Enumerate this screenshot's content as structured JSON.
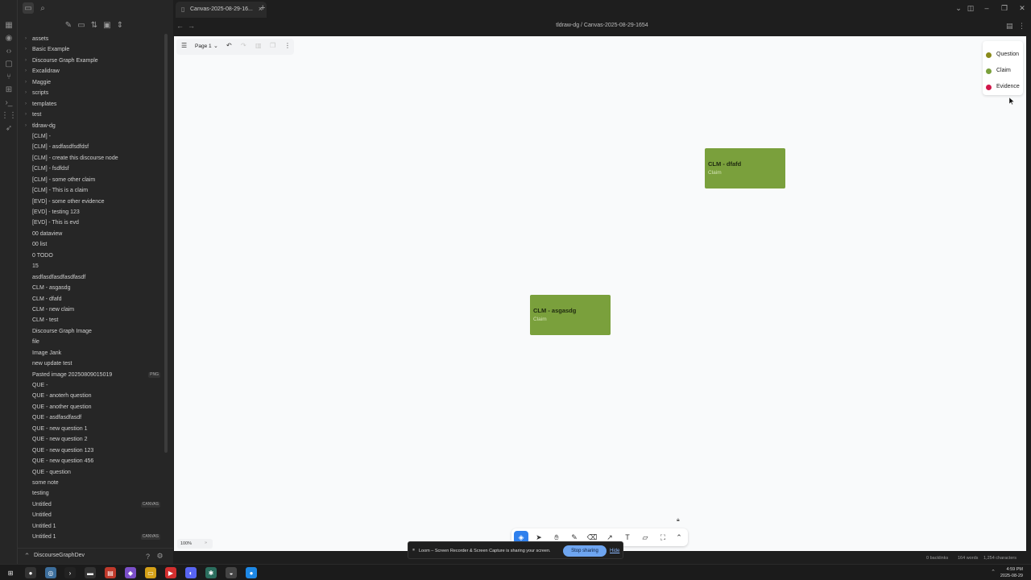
{
  "tab": {
    "title": "Canvas-2025-08-29-16...",
    "close": "×",
    "new_tab": "+"
  },
  "header": {
    "breadcrumb": "tldraw-dg / Canvas-2025-08-29-1654"
  },
  "explorer": {
    "items": [
      {
        "label": "assets",
        "folder": true
      },
      {
        "label": "Basic Example",
        "folder": true
      },
      {
        "label": "Discourse Graph Example",
        "folder": true
      },
      {
        "label": "Excalidraw",
        "folder": true
      },
      {
        "label": "Maggie",
        "folder": true
      },
      {
        "label": "scripts",
        "folder": true
      },
      {
        "label": "templates",
        "folder": true
      },
      {
        "label": "test",
        "folder": true
      },
      {
        "label": "tldraw-dg",
        "folder": true
      },
      {
        "label": "[CLM] -"
      },
      {
        "label": "[CLM] - asdfasdfsdfdsf"
      },
      {
        "label": "[CLM] - create this discourse node"
      },
      {
        "label": "[CLM] - fsdfdsf"
      },
      {
        "label": "[CLM] - some other claim"
      },
      {
        "label": "[CLM] - This is a claim"
      },
      {
        "label": "[EVD] - some other evidence"
      },
      {
        "label": "[EVD] - testing 123"
      },
      {
        "label": "[EVD] - This is evd"
      },
      {
        "label": "00 dataview"
      },
      {
        "label": "00 list"
      },
      {
        "label": "0 TODO"
      },
      {
        "label": "15"
      },
      {
        "label": "asdfasdfasdfasdfasdf"
      },
      {
        "label": "CLM - asgasdg"
      },
      {
        "label": "CLM - dfafd"
      },
      {
        "label": "CLM - new claim"
      },
      {
        "label": "CLM - test"
      },
      {
        "label": "Discourse Graph Image"
      },
      {
        "label": "file"
      },
      {
        "label": "Image Jank"
      },
      {
        "label": "new update test"
      },
      {
        "label": "Pasted image 20250809015019",
        "tag": "PNG"
      },
      {
        "label": "QUE -"
      },
      {
        "label": "QUE - anoterh question"
      },
      {
        "label": "QUE - another question"
      },
      {
        "label": "QUE - asdfasdfasdf"
      },
      {
        "label": "QUE - new question 1"
      },
      {
        "label": "QUE - new question 2"
      },
      {
        "label": "QUE - new question 123"
      },
      {
        "label": "QUE - new question 456"
      },
      {
        "label": "QUE - question"
      },
      {
        "label": "some note"
      },
      {
        "label": "testing"
      },
      {
        "label": "Untitled",
        "tag": "CANVAS"
      },
      {
        "label": "Untitled"
      },
      {
        "label": "Untitled 1"
      },
      {
        "label": "Untitled 1",
        "tag": "CANVAS"
      }
    ]
  },
  "vault": {
    "name": "DiscourseGraphDev"
  },
  "canvas_toolbar": {
    "page": "Page 1"
  },
  "legend": {
    "items": [
      {
        "label": "Question",
        "color": "#8a8a1a"
      },
      {
        "label": "Claim",
        "color": "#7aa03c"
      },
      {
        "label": "Evidence",
        "color": "#d1164a"
      }
    ]
  },
  "nodes": {
    "node1": {
      "title": "CLM - dfafd",
      "type": "Claim",
      "color": "#7aa03c"
    },
    "node2": {
      "title": "CLM - asgasdg",
      "type": "Claim",
      "color": "#7aa03c"
    }
  },
  "zoom": {
    "level": "100%",
    "expand": "»"
  },
  "loom": {
    "message": "Loom – Screen Recorder & Screen Capture is sharing your screen.",
    "stop": "Stop sharing",
    "hide": "Hide"
  },
  "status": {
    "backlinks": "0 backlinks",
    "words": "164 words",
    "chars": "1,254 characters"
  },
  "clock": {
    "time": "4:59 PM",
    "date": "2025-08-29"
  }
}
